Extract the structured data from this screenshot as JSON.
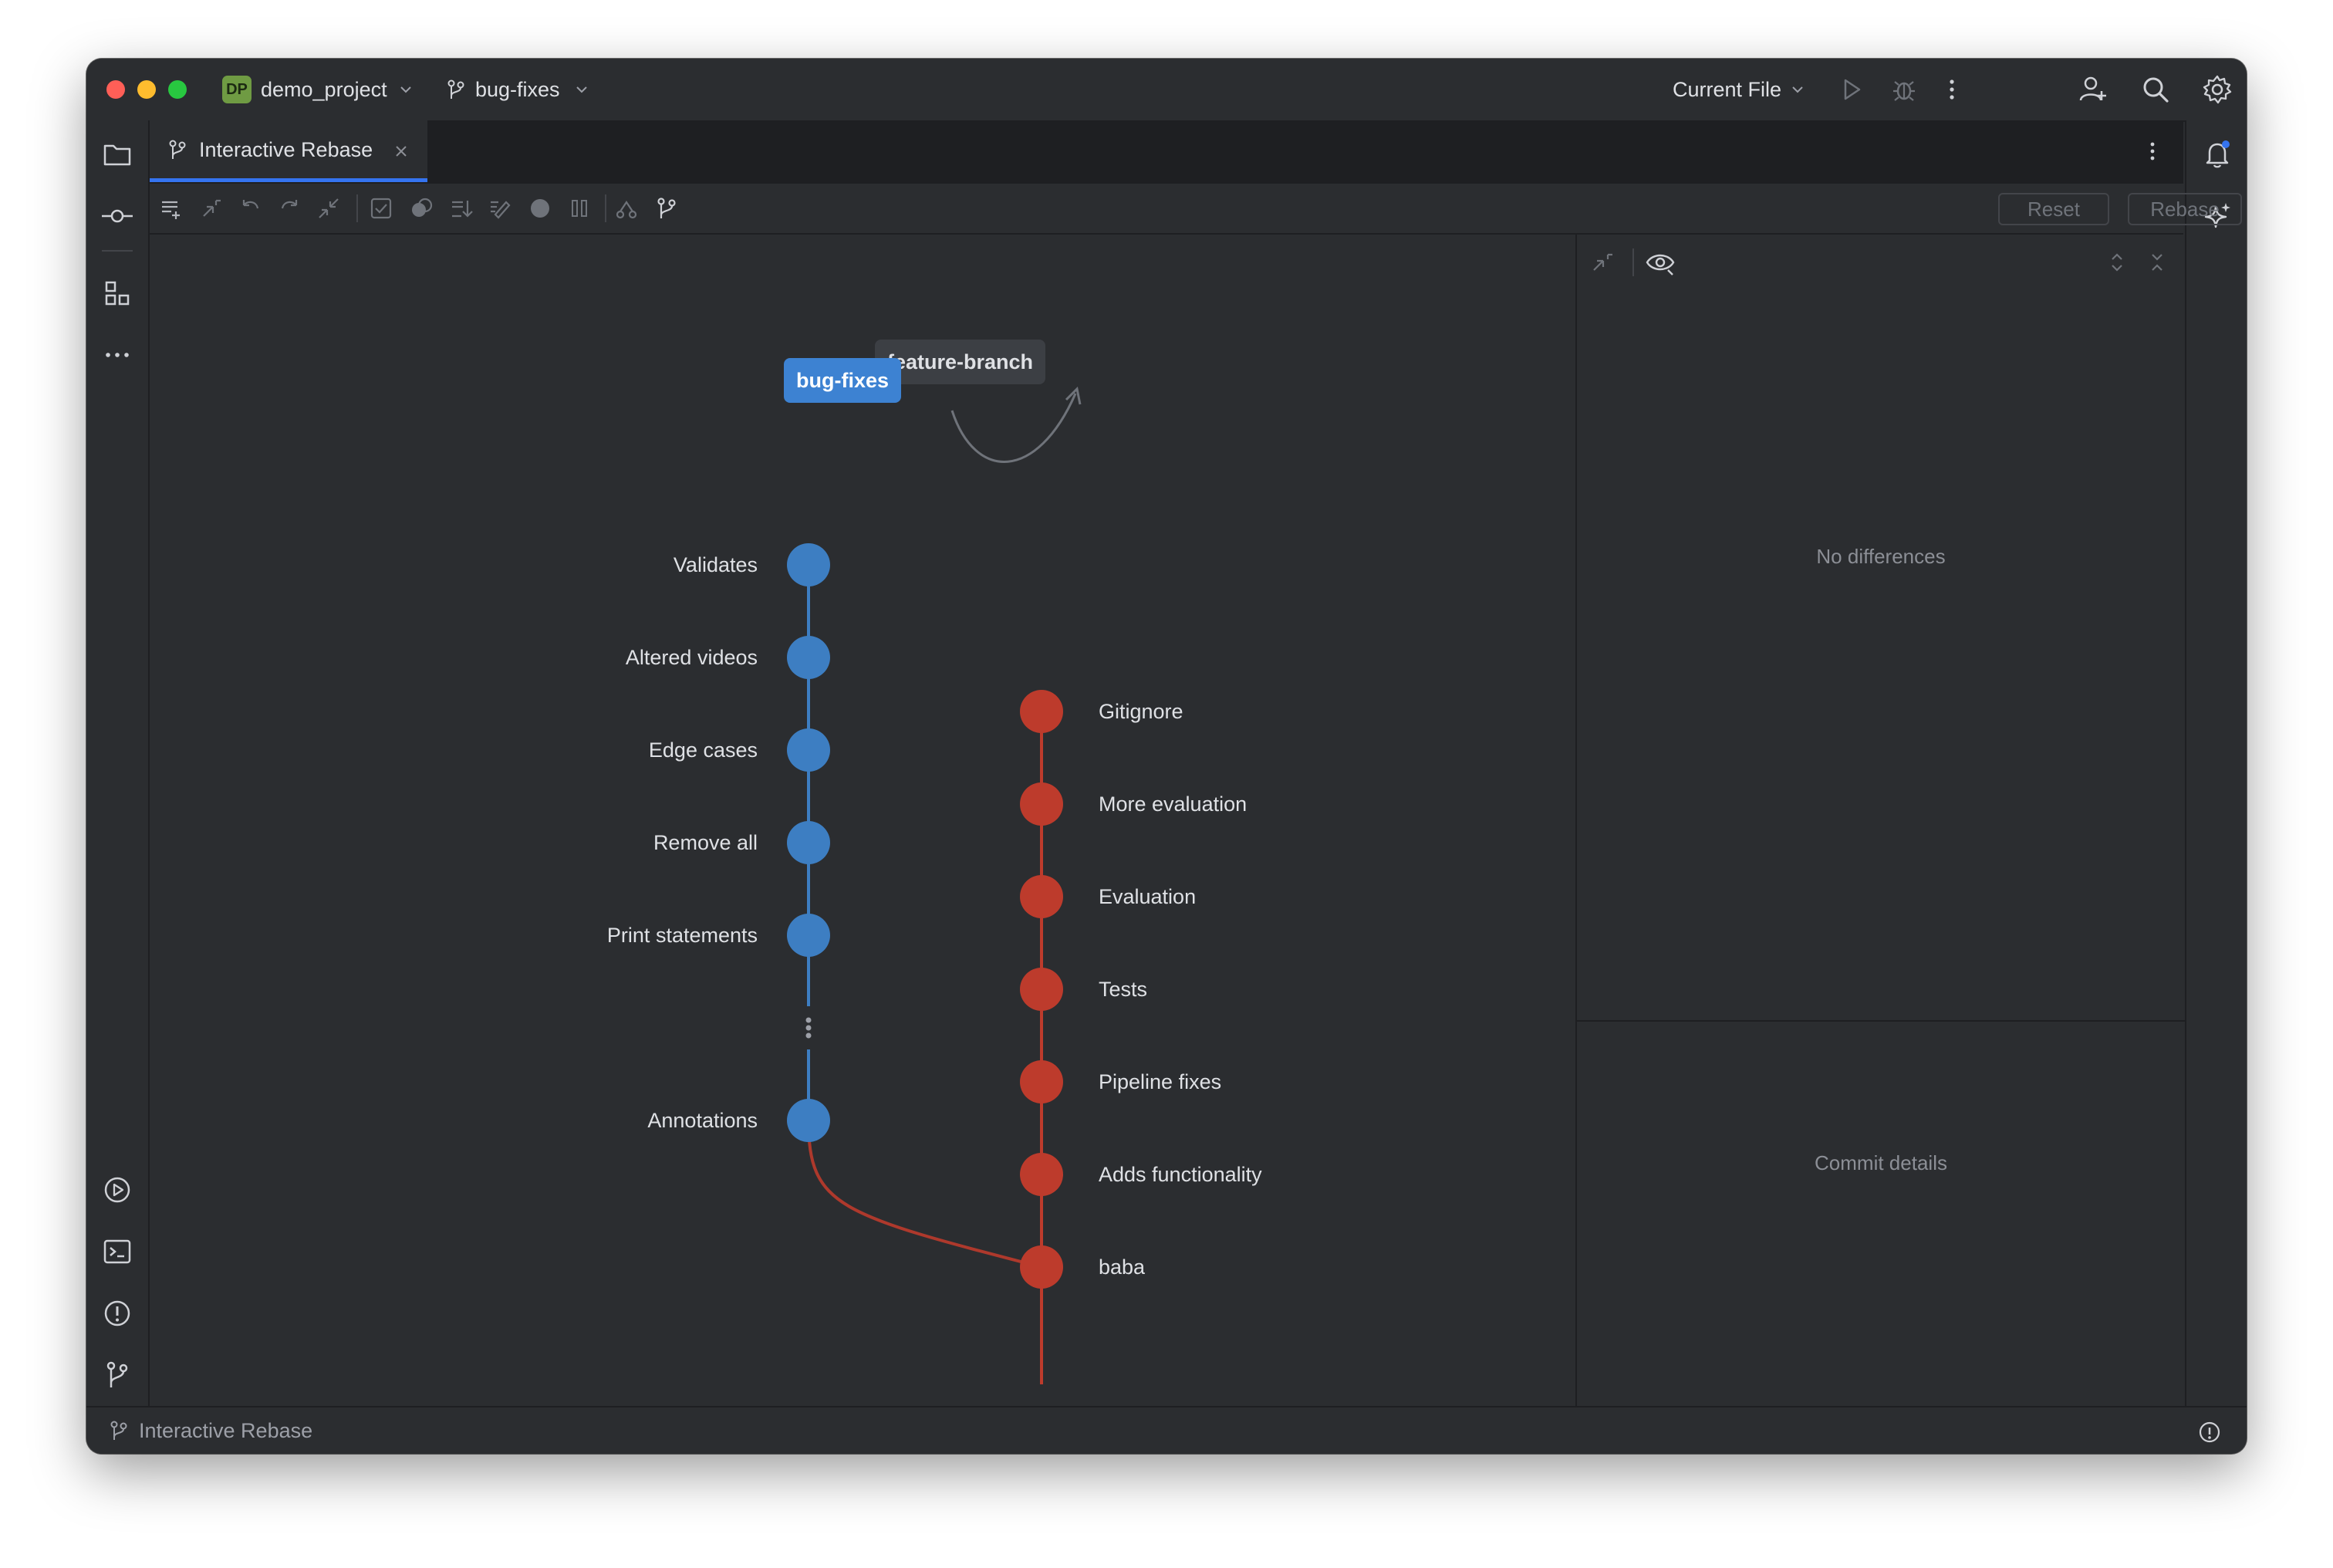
{
  "titlebar": {
    "project_initials": "DP",
    "project_name": "demo_project",
    "branch": "bug-fixes",
    "run_config": "Current File"
  },
  "tabs": [
    {
      "label": "Interactive Rebase",
      "active": true
    }
  ],
  "toolbar": {
    "reset_label": "Reset",
    "rebase_label": "Rebase"
  },
  "graph": {
    "branch_tags": {
      "feature": "feature-branch",
      "bugfix": "bug-fixes"
    },
    "bugfix_commits": [
      "Validates",
      "Altered videos",
      "Edge cases",
      "Remove all",
      "Print statements",
      "Annotations"
    ],
    "feature_commits": [
      "Gitignore",
      "More evaluation",
      "Evaluation",
      "Tests",
      "Pipeline fixes",
      "Adds functionality",
      "baba"
    ],
    "colors": {
      "bugfix": "#3d7ec2",
      "feature": "#bd3b2c"
    },
    "help_label": "?"
  },
  "diff_panel": {
    "empty_label": "No differences",
    "details_label": "Commit details"
  },
  "statusbar": {
    "label": "Interactive Rebase",
    "info_icon": "info-icon"
  }
}
